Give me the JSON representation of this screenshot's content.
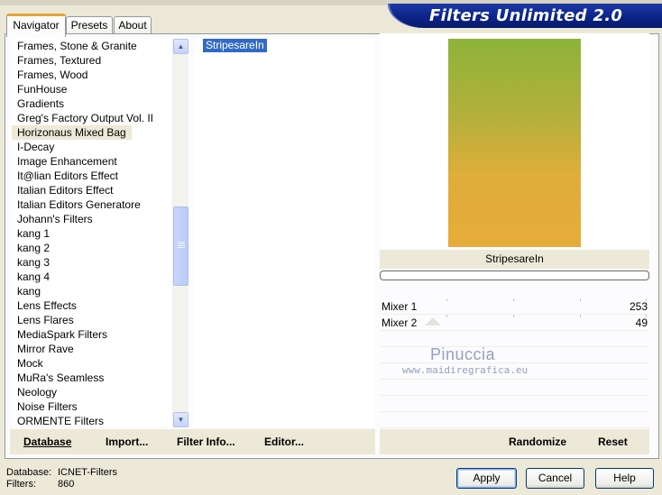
{
  "banner": {
    "title": "Filters Unlimited 2.0"
  },
  "tabs": [
    {
      "label": "Navigator",
      "active": true
    },
    {
      "label": "Presets",
      "active": false
    },
    {
      "label": "About",
      "active": false
    }
  ],
  "filter_categories": {
    "selected": "Horizonaus Mixed Bag",
    "items": [
      "Frames, Stone & Granite",
      "Frames, Textured",
      "Frames, Wood",
      "FunHouse",
      "Gradients",
      "Greg's Factory Output Vol. II",
      "Horizonaus Mixed Bag",
      "I-Decay",
      "Image Enhancement",
      "It@lian Editors Effect",
      "Italian Editors Effect",
      "Italian Editors Generatore",
      "Johann's Filters",
      "kang 1",
      "kang 2",
      "kang 3",
      "kang 4",
      "kang",
      "Lens Effects",
      "Lens Flares",
      "MediaSpark Filters",
      "Mirror Rave",
      "Mock",
      "MuRa's Seamless",
      "Neology",
      "Noise Filters",
      "ORMENTE Filters"
    ]
  },
  "effects": {
    "selected": "StripesareIn"
  },
  "preview": {
    "effect_name": "StripesareIn",
    "colors": [
      "#8db33a",
      "#e6ac39"
    ]
  },
  "mixers": [
    {
      "label": "Mixer 1",
      "value": "253"
    },
    {
      "label": "Mixer 2",
      "value": "49"
    }
  ],
  "watermark": {
    "name": "Pinuccia",
    "url": "www.maidiregrafica.eu"
  },
  "left_buttons": {
    "database": "Database",
    "import": "Import...",
    "filter_info": "Filter Info...",
    "editor": "Editor..."
  },
  "right_buttons": {
    "randomize": "Randomize",
    "reset": "Reset"
  },
  "status": {
    "database_label": "Database:",
    "database_value": "ICNET-Filters",
    "filters_label": "Filters:",
    "filters_value": "860"
  },
  "dialog_buttons": {
    "apply": "Apply",
    "cancel": "Cancel",
    "help": "Help"
  }
}
